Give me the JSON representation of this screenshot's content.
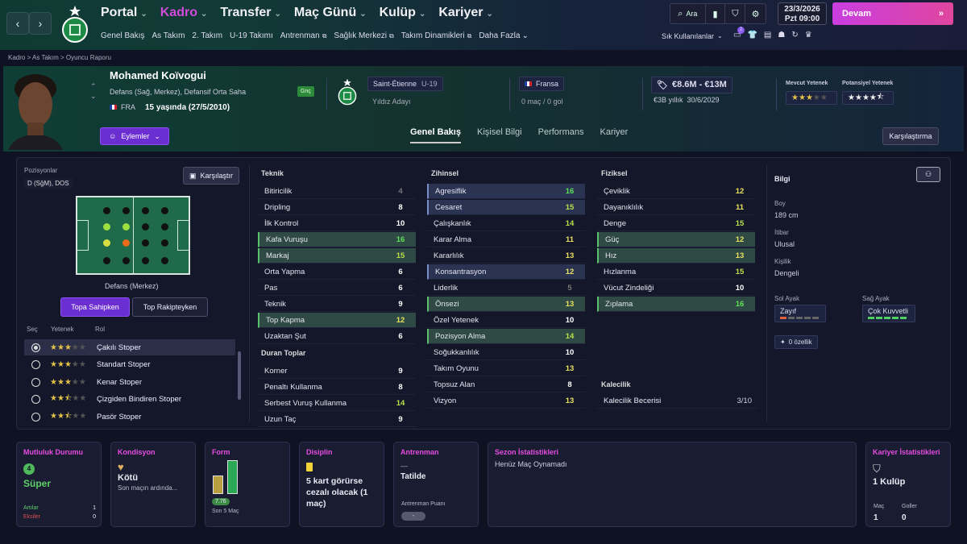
{
  "nav": {
    "main": [
      {
        "label": "Portal",
        "active": false
      },
      {
        "label": "Kadro",
        "active": true
      },
      {
        "label": "Transfer",
        "active": false
      },
      {
        "label": "Maç Günü",
        "active": false
      },
      {
        "label": "Kulüp",
        "active": false
      },
      {
        "label": "Kariyer",
        "active": false
      }
    ],
    "sub": [
      "Genel Bakış",
      "As Takım",
      "2. Takım",
      "U-19 Takımı",
      "Antrenman",
      "Sağlık Merkezi",
      "Takım Dinamikleri",
      "Daha Fazla"
    ],
    "search_label": "Ara",
    "date": "23/3/2026",
    "day_time": "Pzt  09:00",
    "continue_label": "Devam",
    "favorites": "Sık Kullanılanlar",
    "notif_count": "2"
  },
  "breadcrumb": [
    "Kadro",
    "As Takım",
    "Oyuncu Raporu"
  ],
  "player": {
    "name": "Mohamed Koïvogui",
    "positions": "Defans (Sağ, Merkez), Defansif Orta Saha",
    "nationality": "FRA",
    "age": "15 yaşında (27/5/2010)",
    "badge": "Gnç",
    "actions_label": "Eylemler",
    "club": "Saint-Étienne",
    "club_team": "U-19",
    "status": "Yıldız Adayı",
    "country": "Fransa",
    "caps": "0 maç / 0 gol",
    "value": "€8.6M - €13M",
    "wage": "€3B yıllık",
    "contract": "30/6/2029",
    "current_label": "Mevcut Yetenek",
    "potential_label": "Potansiyel Yetenek",
    "current_ability_stars": 3,
    "potential_ability_stars": 4.5
  },
  "tabs": [
    "Genel Bakış",
    "Kişisel Bilgi",
    "Performans",
    "Kariyer"
  ],
  "compare_label": "Karşılaştırma",
  "positions_panel": {
    "title": "Pozisyonlar",
    "value": "D (SğM), DOS",
    "compare_label": "Karşılaştır",
    "pitch_label": "Defans (Merkez)",
    "tab_in": "Topa Sahipken",
    "tab_out": "Top Rakipteyken",
    "col_select": "Seç",
    "col_ability": "Yetenek",
    "col_role": "Rol",
    "roles": [
      {
        "name": "Çakılı Stoper",
        "stars": 3,
        "selected": true
      },
      {
        "name": "Standart Stoper",
        "stars": 3,
        "selected": false
      },
      {
        "name": "Kenar Stoper",
        "stars": 3,
        "selected": false
      },
      {
        "name": "Çizgiden Bindiren Stoper",
        "stars": 2.5,
        "selected": false
      },
      {
        "name": "Pasör Stoper",
        "stars": 2.5,
        "selected": false
      }
    ]
  },
  "technical": {
    "title": "Teknik",
    "items": [
      [
        "Bitiricilik",
        "4",
        "dim"
      ],
      [
        "Dripling",
        "8",
        ""
      ],
      [
        "İlk Kontrol",
        "10",
        ""
      ],
      [
        "Kafa Vuruşu",
        "16",
        "hg"
      ],
      [
        "Markaj",
        "15",
        "hg"
      ],
      [
        "Orta Yapma",
        "6",
        ""
      ],
      [
        "Pas",
        "6",
        ""
      ],
      [
        "Teknik",
        "9",
        ""
      ],
      [
        "Top Kapma",
        "12",
        "hg"
      ],
      [
        "Uzaktan Şut",
        "6",
        ""
      ]
    ]
  },
  "set_pieces": {
    "title": "Duran Toplar",
    "items": [
      [
        "Korner",
        "9",
        ""
      ],
      [
        "Penaltı Kullanma",
        "8",
        ""
      ],
      [
        "Serbest Vuruş Kullanma",
        "14",
        ""
      ],
      [
        "Uzun Taç",
        "9",
        ""
      ]
    ]
  },
  "mental": {
    "title": "Zihinsel",
    "items": [
      [
        "Agresiflik",
        "16",
        "hb"
      ],
      [
        "Cesaret",
        "15",
        "hb"
      ],
      [
        "Çalışkanlık",
        "14",
        ""
      ],
      [
        "Karar Alma",
        "11",
        ""
      ],
      [
        "Kararlılık",
        "13",
        ""
      ],
      [
        "Konsantrasyon",
        "12",
        "hb"
      ],
      [
        "Liderlik",
        "5",
        "dim"
      ],
      [
        "Önsezi",
        "13",
        "hg"
      ],
      [
        "Özel Yetenek",
        "10",
        ""
      ],
      [
        "Pozisyon Alma",
        "14",
        "hg"
      ],
      [
        "Soğukkanlılık",
        "10",
        ""
      ],
      [
        "Takım Oyunu",
        "13",
        ""
      ],
      [
        "Topsuz Alan",
        "8",
        ""
      ],
      [
        "Vizyon",
        "13",
        ""
      ]
    ]
  },
  "physical": {
    "title": "Fiziksel",
    "items": [
      [
        "Çeviklik",
        "12",
        ""
      ],
      [
        "Dayanıklılık",
        "11",
        ""
      ],
      [
        "Denge",
        "15",
        ""
      ],
      [
        "Güç",
        "12",
        "hg"
      ],
      [
        "Hız",
        "13",
        "hg"
      ],
      [
        "Hızlanma",
        "15",
        ""
      ],
      [
        "Vücut Zindeliği",
        "10",
        ""
      ],
      [
        "Zıplama",
        "16",
        "hg"
      ]
    ]
  },
  "goalkeeping": {
    "title": "Kalecilik",
    "label": "Kalecilik Becerisi",
    "value": "3/10"
  },
  "info": {
    "title": "Bilgi",
    "height_label": "Boy",
    "height": "189 cm",
    "rep_label": "İtibar",
    "rep": "Ulusal",
    "pers_label": "Kişilik",
    "pers": "Dengeli",
    "left_label": "Sol Ayak",
    "left": "Zayıf",
    "right_label": "Sağ Ayak",
    "right": "Çok Kuvvetli",
    "traits": "0 özellik"
  },
  "cards": {
    "happiness": {
      "title": "Mutluluk Durumu",
      "value": "Süper",
      "badge": "4",
      "pos_label": "Artılar",
      "pos": "1",
      "neg_label": "Eksiler",
      "neg": "0"
    },
    "condition": {
      "title": "Kondisyon",
      "value": "Kötü",
      "desc": "Son maçın ardında..."
    },
    "form": {
      "title": "Form",
      "rating": "7.76",
      "caption": "Son 5 Maç",
      "bars": [
        0.55,
        1.0
      ]
    },
    "discipline": {
      "title": "Disiplin",
      "text": "5 kart görürse cezalı olacak (1 maç)"
    },
    "training": {
      "title": "Antrenman",
      "dash": "—",
      "value": "Tatilde",
      "rating_label": "Antrenman Puanı",
      "rating": "-"
    },
    "season": {
      "title": "Sezon İstatistikleri",
      "text": "Henüz Maç Oynamadı"
    },
    "career": {
      "title": "Kariyer İstatistikleri",
      "value": "1 Kulüp",
      "apps_label": "Maç",
      "apps": "1",
      "goals_label": "Goller",
      "goals": "0"
    }
  },
  "colors": {
    "accent": "#d24bdb",
    "green": "#5ac06d",
    "purple": "#6b2ed0"
  }
}
